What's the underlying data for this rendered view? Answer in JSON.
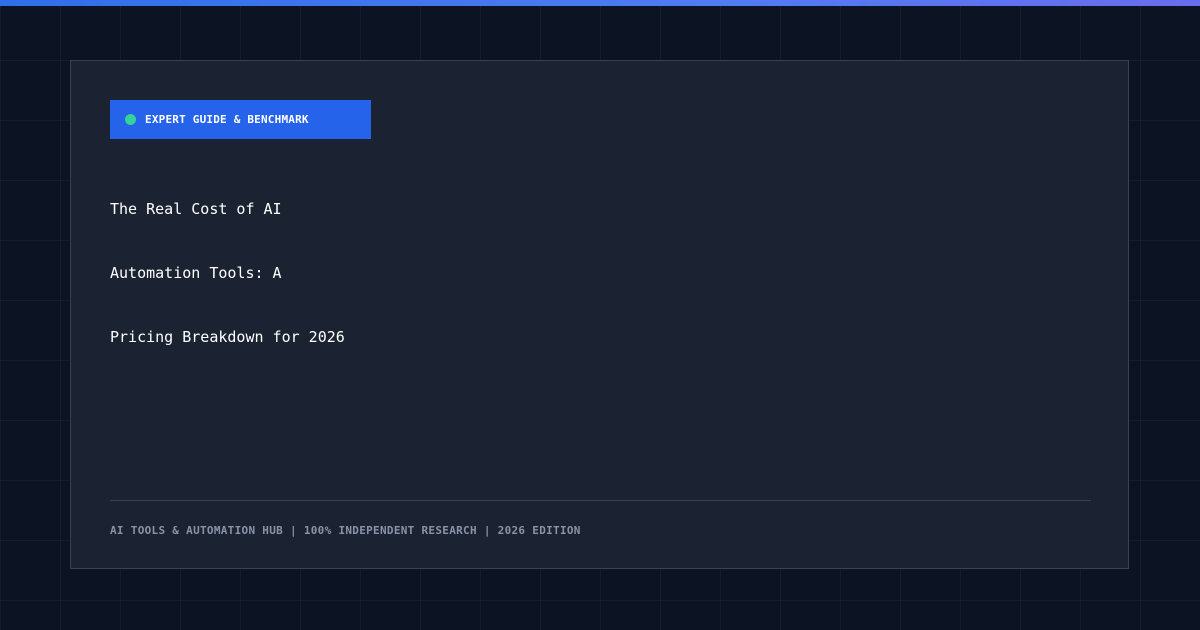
{
  "colors": {
    "background": "#0c1424",
    "card": "#1b2333",
    "card_border": "#36415a",
    "accent": "#2563eb",
    "dot": "#34d399",
    "top_bar": "#4f7cf2",
    "title_text": "#ffffff",
    "footer_text": "#8a93a6"
  },
  "badge": {
    "label": "EXPERT GUIDE & BENCHMARK",
    "icon": "status-dot-icon"
  },
  "title": {
    "lines": [
      "The Real Cost of AI",
      "Automation Tools: A",
      "Pricing Breakdown for 2026"
    ]
  },
  "footer": {
    "text": "AI TOOLS & AUTOMATION HUB | 100% INDEPENDENT RESEARCH | 2026 EDITION"
  }
}
